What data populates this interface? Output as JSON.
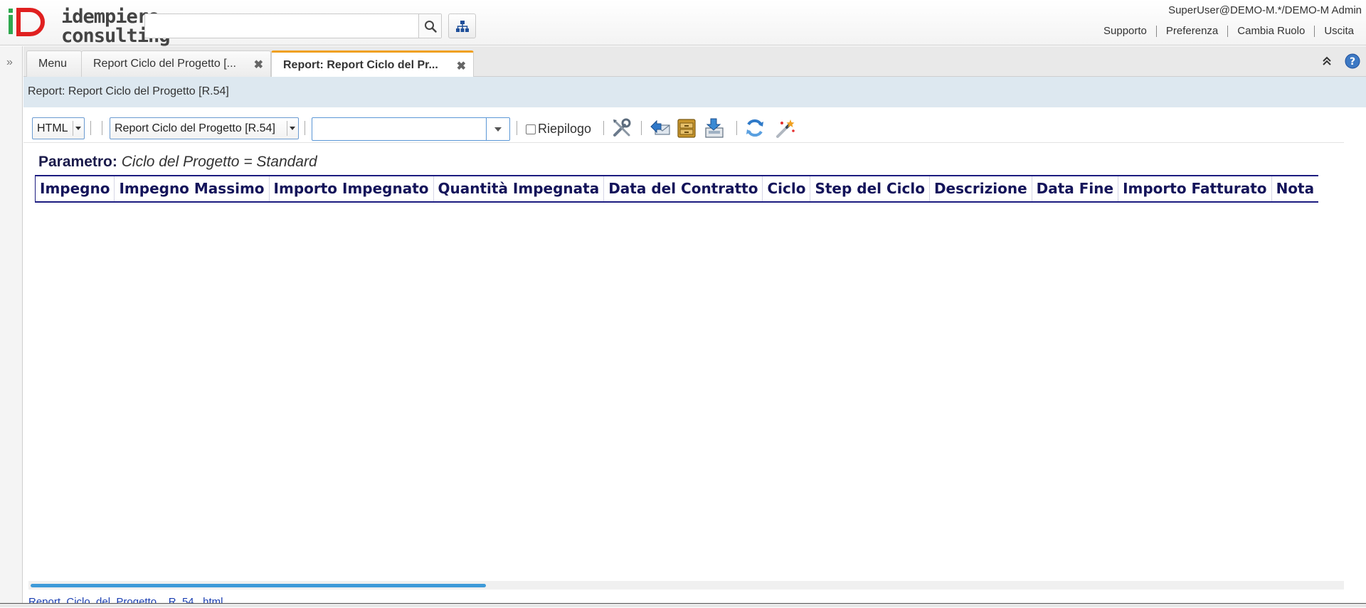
{
  "header": {
    "logo_text_1": "idempiere",
    "logo_text_2": "consulting",
    "search_placeholder": "",
    "user": "SuperUser@DEMO-M.*/DEMO-M Admin",
    "links": [
      "Supporto",
      "Preferenza",
      "Cambia Ruolo",
      "Uscita"
    ]
  },
  "tabs": [
    {
      "label": "Menu"
    },
    {
      "label": "Report Ciclo del Progetto [..."
    },
    {
      "label": "Report: Report Ciclo del Pr..."
    }
  ],
  "window": {
    "title": "Report: Report Ciclo del Progetto [R.54]"
  },
  "toolbar": {
    "format_selected": "HTML",
    "print_format_selected": "Report Ciclo del Progetto [R.54]",
    "combo_value": "",
    "summary_label": "Riepilogo",
    "summary_checked": false
  },
  "report": {
    "param_label": "Parametro:",
    "param_value": "Ciclo del Progetto = Standard",
    "columns": [
      "Impegno",
      "Impegno Massimo",
      "Importo Impegnato",
      "Quantità Impegnata",
      "Data del Contratto",
      "Ciclo",
      "Step del Ciclo",
      "Descrizione",
      "Data Fine",
      "Importo Fatturato",
      "Nota"
    ]
  },
  "footer": {
    "file_link": "Report_Ciclo_del_Progetto__R_54_.html"
  },
  "colors": {
    "accent_tab": "#f0a020",
    "title_bg": "#dde8f0",
    "table_header_text": "#14145a",
    "scroll_thumb": "#3e9ad8"
  }
}
